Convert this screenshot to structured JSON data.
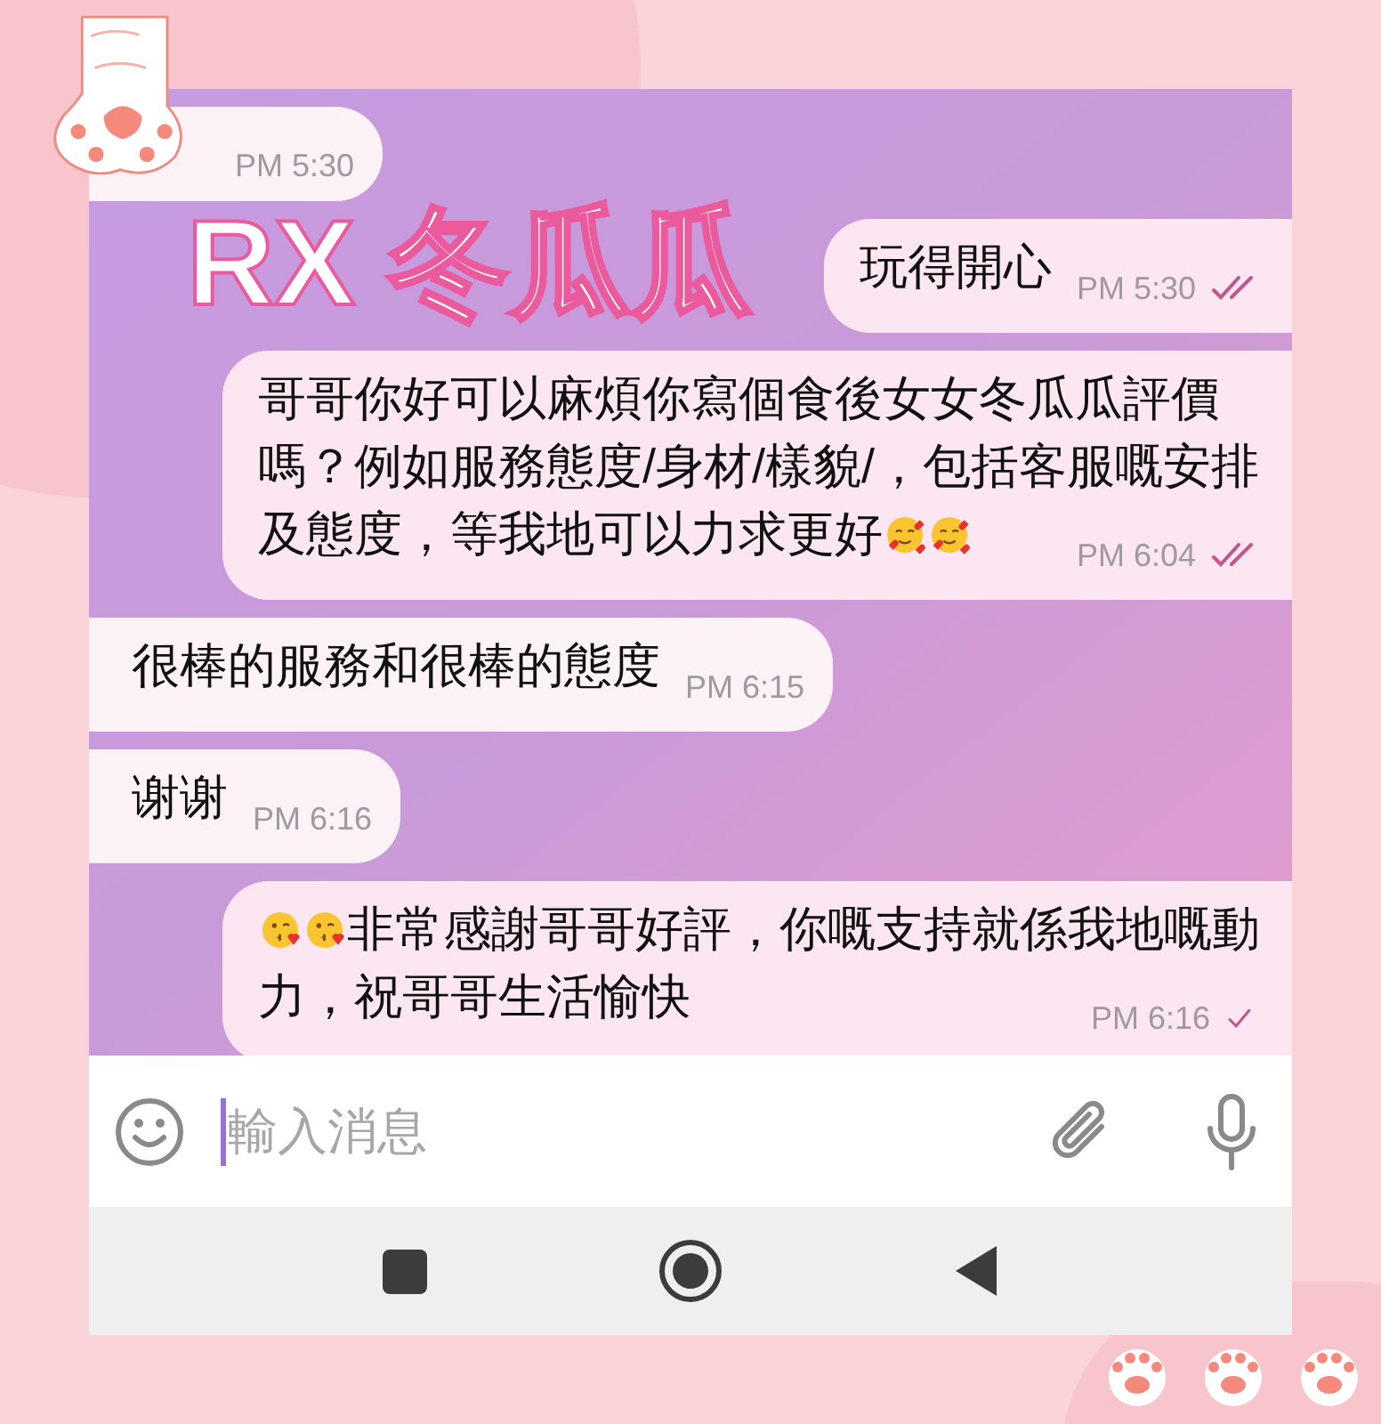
{
  "overlay_title": "RX 冬瓜瓜",
  "messages": [
    {
      "kind": "incoming",
      "time": "PM 5:30"
    },
    {
      "kind": "outgoing",
      "text": "玩得開心",
      "time": "PM 5:30",
      "read": true
    },
    {
      "kind": "outgoing",
      "text": "哥哥你好可以麻煩你寫個食後女女冬瓜瓜評價嗎？例如服務態度/身材/樣貌/，包括客服嘅安排及態度，等我地可以力求更好",
      "emoji_after": [
        {
          "kind": "smiling-hearts"
        },
        {
          "kind": "smiling-hearts"
        }
      ],
      "time": "PM 6:04",
      "read": true
    },
    {
      "kind": "incoming",
      "text": "很棒的服務和很棒的態度",
      "time": "PM 6:15"
    },
    {
      "kind": "incoming",
      "text": "谢谢",
      "time": "PM 6:16"
    },
    {
      "kind": "outgoing",
      "emoji_before": [
        {
          "kind": "kissing-heart"
        },
        {
          "kind": "kissing-heart"
        }
      ],
      "text": "非常感謝哥哥好評，你嘅支持就係我地嘅動力，祝哥哥生活愉快",
      "time": "PM 6:16",
      "read": false
    }
  ],
  "composer": {
    "placeholder": "輸入消息"
  }
}
